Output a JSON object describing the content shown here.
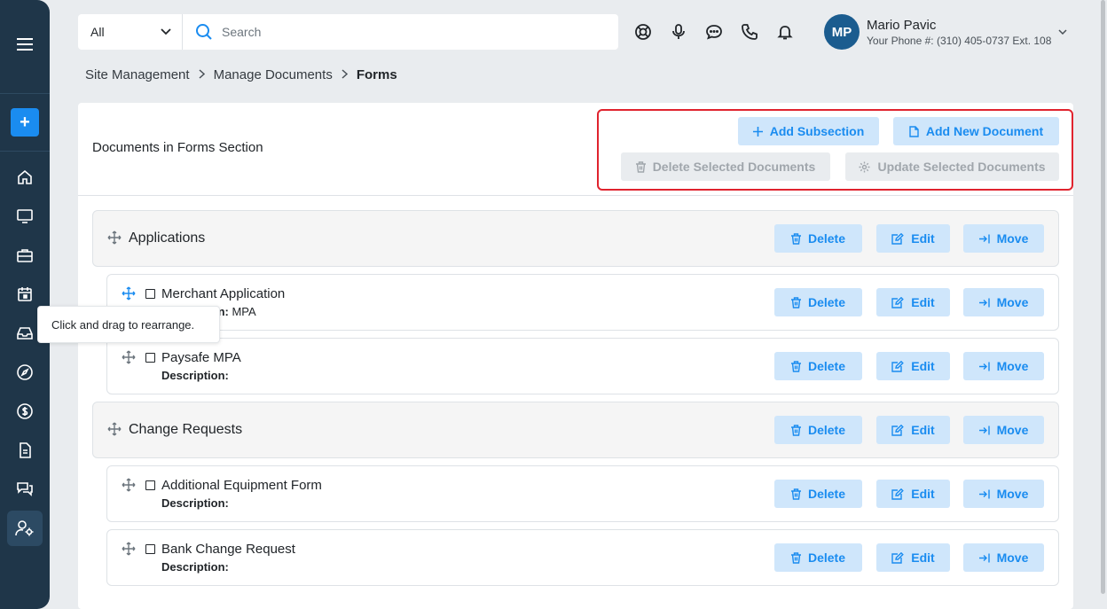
{
  "search": {
    "scope": "All",
    "placeholder": "Search"
  },
  "user": {
    "initials": "MP",
    "name": "Mario Pavic",
    "phone": "Your Phone #: (310) 405-0737 Ext. 108"
  },
  "breadcrumb": {
    "item1": "Site Management",
    "item2": "Manage Documents",
    "current": "Forms"
  },
  "card": {
    "title": "Documents in Forms Section",
    "add_subsection": "Add Subsection",
    "add_document": "Add New Document",
    "delete_selected": "Delete Selected Documents",
    "update_selected": "Update Selected Documents"
  },
  "row_actions": {
    "delete": "Delete",
    "edit": "Edit",
    "move": "Move"
  },
  "rows": [
    {
      "type": "section",
      "title": "Applications"
    },
    {
      "type": "doc",
      "title": "Merchant Application",
      "desc_label": "Description:",
      "desc_value": "MPA"
    },
    {
      "type": "doc",
      "title": "Paysafe MPA",
      "desc_label": "Description:",
      "desc_value": ""
    },
    {
      "type": "section",
      "title": "Change Requests"
    },
    {
      "type": "doc",
      "title": "Additional Equipment Form",
      "desc_label": "Description:",
      "desc_value": ""
    },
    {
      "type": "doc",
      "title": "Bank Change Request",
      "desc_label": "Description:",
      "desc_value": ""
    }
  ],
  "tooltip": "Click and drag to rearrange.",
  "colors": {
    "sidebar": "#1f3649",
    "accent": "#1a8cf0",
    "highlight": "#e0232e"
  }
}
